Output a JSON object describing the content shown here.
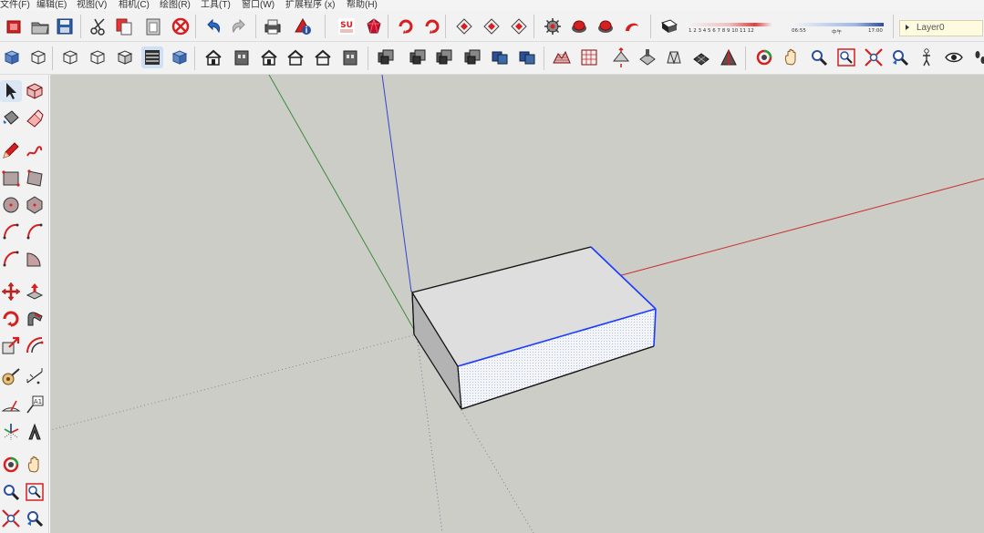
{
  "menu": [
    {
      "id": "file",
      "label": "文件(F)"
    },
    {
      "id": "edit",
      "label": "编辑(E)"
    },
    {
      "id": "view",
      "label": "视图(V)"
    },
    {
      "id": "camera",
      "label": "相机(C)"
    },
    {
      "id": "draw",
      "label": "绘图(R)"
    },
    {
      "id": "tools",
      "label": "工具(T)"
    },
    {
      "id": "window",
      "label": "窗口(W)"
    },
    {
      "id": "extensions",
      "label": "扩展程序 (x)"
    },
    {
      "id": "help",
      "label": "帮助(H)"
    }
  ],
  "shadow_settings": {
    "month_labels": "1 2 3 4 5 6 7 8 9 10 11 12",
    "time_start": "06:55",
    "time_mid": "中午",
    "time_end": "17:00"
  },
  "layer": {
    "current": "Layer0"
  },
  "colors": {
    "viewport_bg": "#cdcdc8",
    "red_axis": "#c83232",
    "green_axis": "#3c8c3c",
    "blue_axis": "#3344cc",
    "selection_blue": "#1a3cff",
    "box_top": "#dedede",
    "box_front": "#f4f4f4",
    "box_side": "#b0b0b0"
  },
  "icons": {
    "toolbar_top": [
      "new-model-icon",
      "open-icon",
      "save-icon",
      "cut-icon",
      "copy-icon",
      "paste-icon",
      "erase-icon",
      "undo-icon",
      "redo-icon",
      "print-icon",
      "model-info-icon",
      "su-app-icon",
      "ruby-icon",
      "follow-me-icon",
      "rotate-red-icon",
      "intersect-icon",
      "outer-shell-icon",
      "subtract-icon",
      "trim-icon",
      "split-icon",
      "union-icon",
      "solid-inspector-icon",
      "shadows-toggle-icon"
    ],
    "toolbar_second": [
      "xray-icon",
      "back-edges-icon",
      "wireframe-icon",
      "hidden-line-icon",
      "shaded-icon",
      "shaded-texture-icon",
      "monochrome-icon",
      "iso-view-icon",
      "top-view-icon",
      "front-view-icon",
      "right-view-icon",
      "back-view-icon",
      "left-view-icon",
      "stack-a-icon",
      "stack-b-icon",
      "stack-c-icon",
      "stack-d-icon",
      "stack-e-icon",
      "stack-f-icon",
      "sandbox-contours-icon",
      "sandbox-scratch-icon",
      "smoove-icon",
      "stamp-icon",
      "drape-icon",
      "add-detail-icon",
      "flip-edge-icon",
      "orbit-icon",
      "pan-icon",
      "zoom-icon",
      "zoom-window-icon",
      "zoom-extents-icon",
      "previous-view-icon",
      "position-camera-icon",
      "look-around-icon",
      "walk-icon"
    ],
    "toolbar_left": [
      "select-icon",
      "make-component-icon",
      "paint-bucket-icon",
      "eraser-icon",
      "line-icon",
      "freehand-icon",
      "rectangle-icon",
      "rotated-rectangle-icon",
      "circle-icon",
      "polygon-icon",
      "arc-icon",
      "two-point-arc-icon",
      "three-point-arc-icon",
      "pie-icon",
      "move-icon",
      "push-pull-icon",
      "rotate-icon",
      "follow-me-tool-icon",
      "scale-icon",
      "offset-icon",
      "tape-measure-icon",
      "dimension-icon",
      "protractor-icon",
      "text-icon",
      "axes-icon",
      "3d-text-icon",
      "orbit-tool-icon",
      "pan-tool-icon",
      "zoom-tool-icon",
      "zoom-window-tool-icon",
      "zoom-extents-tool-icon",
      "previous-tool-icon"
    ]
  }
}
